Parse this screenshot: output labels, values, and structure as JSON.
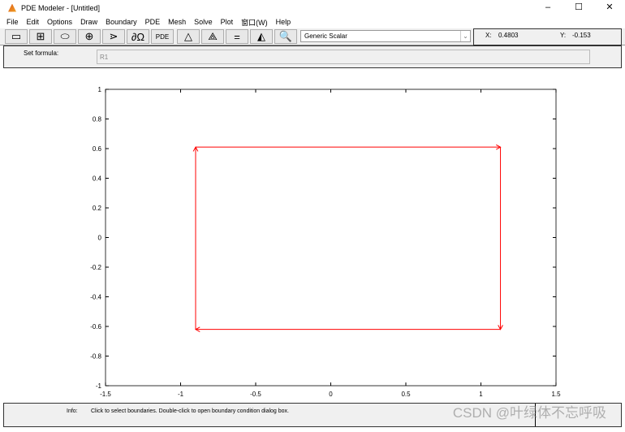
{
  "window": {
    "title": "PDE Modeler - [Untitled]",
    "controls": [
      "–",
      "☐",
      "✕"
    ]
  },
  "menu": [
    "File",
    "Edit",
    "Options",
    "Draw",
    "Boundary",
    "PDE",
    "Mesh",
    "Solve",
    "Plot",
    "窗口(W)",
    "Help"
  ],
  "toolbar": {
    "buttons": [
      {
        "name": "rectangle-button",
        "glyph": "▭"
      },
      {
        "name": "rectangle-center-button",
        "glyph": "⊞"
      },
      {
        "name": "ellipse-button",
        "glyph": "⬭"
      },
      {
        "name": "ellipse-center-button",
        "glyph": "⊕"
      },
      {
        "name": "polygon-button",
        "glyph": "⋗"
      },
      {
        "name": "boundary-mode-button",
        "glyph": "∂Ω"
      },
      {
        "name": "pde-spec-button",
        "glyph": "PDE"
      },
      {
        "name": "init-mesh-button",
        "glyph": "△"
      },
      {
        "name": "refine-mesh-button",
        "glyph": "⟁"
      },
      {
        "name": "solve-button",
        "glyph": "="
      },
      {
        "name": "plot-button",
        "glyph": "◭"
      },
      {
        "name": "zoom-button",
        "glyph": "🔍"
      }
    ],
    "application_mode": "Generic Scalar",
    "x_label": "X:",
    "x_value": "0.4803",
    "y_label": "Y:",
    "y_value": "-0.153"
  },
  "formula": {
    "label": "Set formula:",
    "value": "R1"
  },
  "chart_data": {
    "type": "line",
    "xlim": [
      -1.5,
      1.5
    ],
    "ylim": [
      -1,
      1
    ],
    "xticks": [
      "-1.5",
      "-1",
      "-0.5",
      "0",
      "0.5",
      "1",
      "1.5"
    ],
    "yticks": [
      "-1",
      "-0.8",
      "-0.6",
      "-0.4",
      "-0.2",
      "0",
      "0.2",
      "0.4",
      "0.6",
      "0.8",
      "1"
    ],
    "grid": false,
    "series": [
      {
        "values": [
          [
            -0.9,
            -0.62
          ],
          [
            -0.9,
            0.61
          ],
          [
            1.13,
            0.61
          ],
          [
            1.13,
            -0.62
          ],
          [
            -0.9,
            -0.62
          ]
        ],
        "color": "#ff0000"
      }
    ]
  },
  "info": {
    "label": "Info:",
    "text": "Click to select boundaries. Double-click to open boundary condition dialog box."
  },
  "watermark": "CSDN @叶绿体不忘呼吸"
}
